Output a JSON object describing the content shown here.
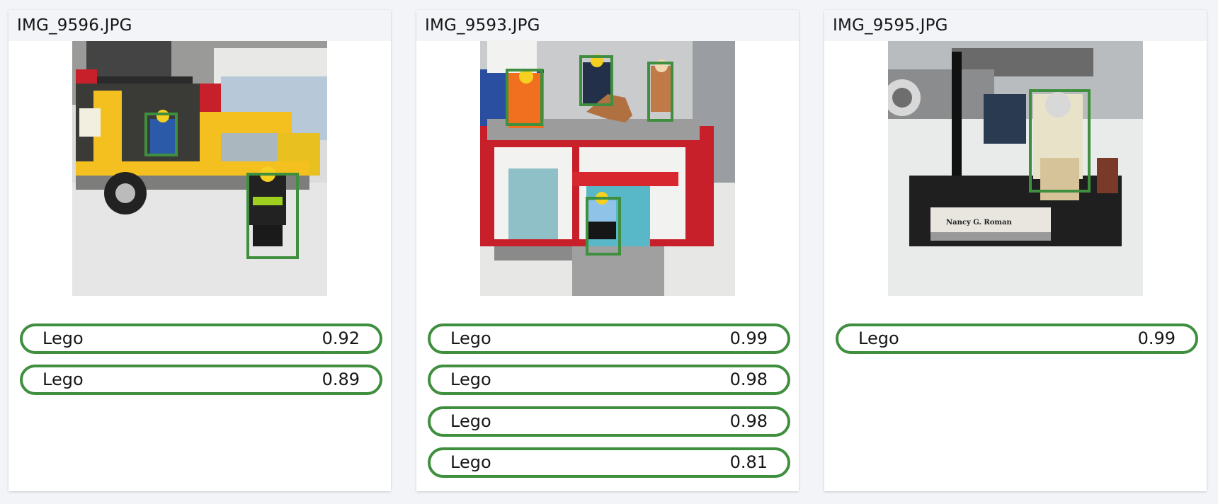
{
  "cards": [
    {
      "filename": "IMG_9596.JPG",
      "image_desc": "lego-food-truck-photo",
      "detections": [
        {
          "label": "Lego",
          "score": "0.92"
        },
        {
          "label": "Lego",
          "score": "0.89"
        }
      ]
    },
    {
      "filename": "IMG_9593.JPG",
      "image_desc": "lego-building-minifigures-photo",
      "detections": [
        {
          "label": "Lego",
          "score": "0.99"
        },
        {
          "label": "Lego",
          "score": "0.98"
        },
        {
          "label": "Lego",
          "score": "0.98"
        },
        {
          "label": "Lego",
          "score": "0.81"
        }
      ]
    },
    {
      "filename": "IMG_9595.JPG",
      "image_desc": "lego-telescope-minifigure-photo",
      "plaque_text": "Nancy G. Roman",
      "detections": [
        {
          "label": "Lego",
          "score": "0.99"
        }
      ]
    }
  ],
  "colors": {
    "detection_green": "#3f8f3f",
    "header_bg": "#f2f4f8",
    "card_bg": "#ffffff"
  }
}
